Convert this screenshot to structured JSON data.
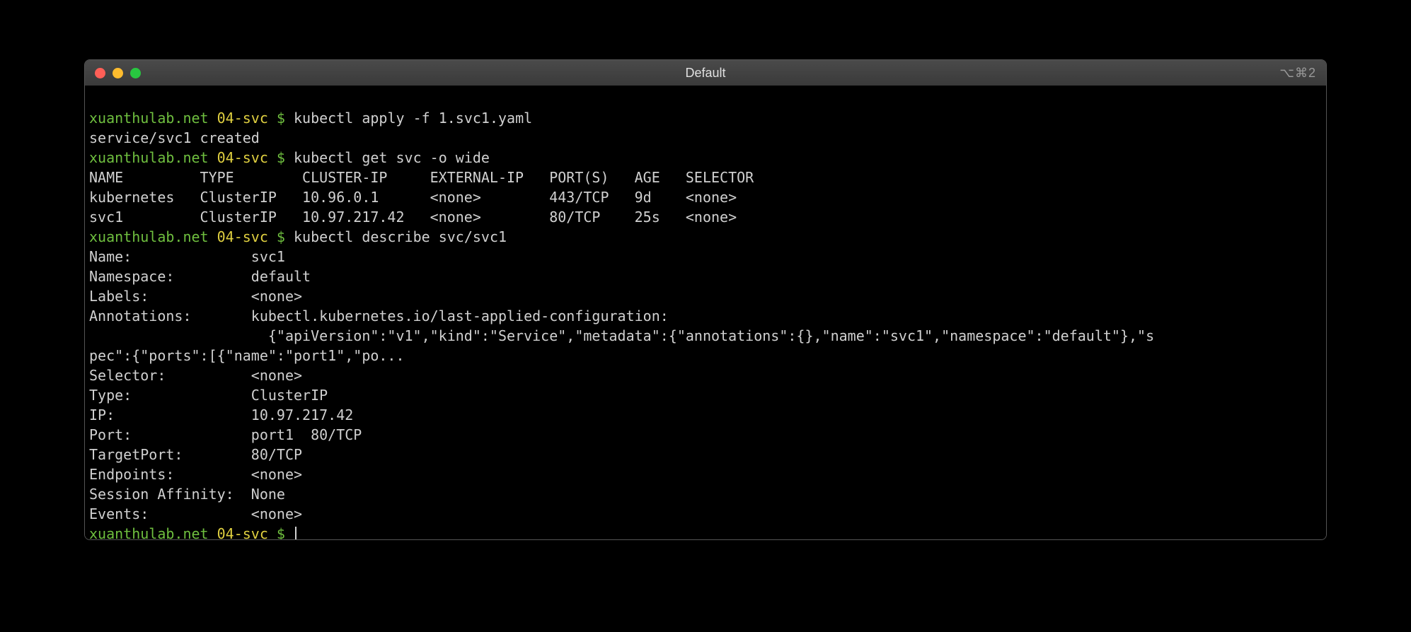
{
  "window": {
    "title": "Default",
    "shortcut": "⌥⌘2"
  },
  "prompt": {
    "host": "xuanthulab.net",
    "dir": "04-svc",
    "symbol": "$"
  },
  "cmd1": "kubectl apply -f 1.svc1.yaml",
  "out1": "service/svc1 created",
  "cmd2": "kubectl get svc -o wide",
  "svc_header": "NAME         TYPE        CLUSTER-IP     EXTERNAL-IP   PORT(S)   AGE   SELECTOR",
  "svc_row1": "kubernetes   ClusterIP   10.96.0.1      <none>        443/TCP   9d    <none>",
  "svc_row2": "svc1         ClusterIP   10.97.217.42   <none>        80/TCP    25s   <none>",
  "cmd3": "kubectl describe svc/svc1",
  "desc": {
    "name": "Name:              svc1",
    "namespace": "Namespace:         default",
    "labels": "Labels:            <none>",
    "annline1": "Annotations:       kubectl.kubernetes.io/last-applied-configuration:",
    "annline2": "                     {\"apiVersion\":\"v1\",\"kind\":\"Service\",\"metadata\":{\"annotations\":{},\"name\":\"svc1\",\"namespace\":\"default\"},\"s",
    "annline3": "pec\":{\"ports\":[{\"name\":\"port1\",\"po...",
    "selector": "Selector:          <none>",
    "type": "Type:              ClusterIP",
    "ip": "IP:                10.97.217.42",
    "port": "Port:              port1  80/TCP",
    "tport": "TargetPort:        80/TCP",
    "endpoints": "Endpoints:         <none>",
    "session": "Session Affinity:  None",
    "events": "Events:            <none>"
  }
}
